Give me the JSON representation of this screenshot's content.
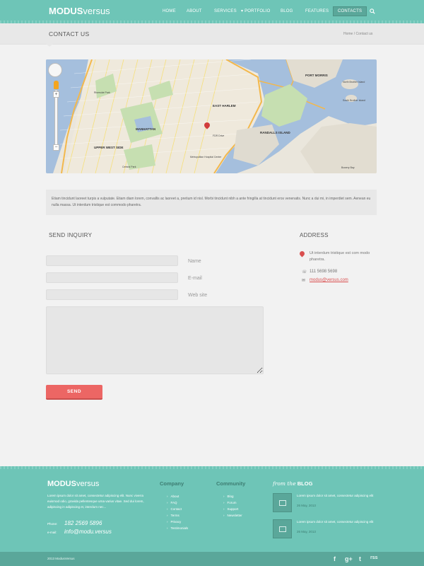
{
  "brand": {
    "name_bold": "MODUS",
    "name_light": "versus"
  },
  "nav": {
    "items": [
      {
        "label": "HOME"
      },
      {
        "label": "ABOUT"
      },
      {
        "label": "SERVICES"
      },
      {
        "label": "PORTFOLIO"
      },
      {
        "label": "BLOG"
      },
      {
        "label": "FEATURES"
      },
      {
        "label": "CONTACTS"
      }
    ],
    "search_icon": "search-icon"
  },
  "titlebar": {
    "title": "CONTACT US",
    "breadcrumb": "Home  /  Contact us"
  },
  "map": {
    "labels": {
      "manhattan": "MANHATTAN",
      "east_harlem": "EAST HARLEM",
      "upper_west_side": "UPPER WEST SIDE",
      "randalls_island": "RANDALLS ISLAND",
      "port_morris": "PORT MORRIS",
      "north_brother": "North Brother Island",
      "south_brother": "South Brother Island",
      "central_park": "Central Park",
      "riverside_park": "Riverside Park",
      "fdr_drive": "FDR Drive",
      "metropolitan": "Metropolitan Hospital Center",
      "riker": "Bowery Bay"
    },
    "zoom_in": "+",
    "zoom_out": "−"
  },
  "intro": {
    "text": "Etiam tincidunt laoreet turpis a vulputate. Etiam diam lorem, convallis ac laoreet a, pretium id nisl. Morbi tincidunt nibh a ante fringilla at tincidunt eros venenatis. Nunc a dui mi, in imperdiet sem. Aenean eu nulla massa. Ut interdum tristique est commodo pharetra."
  },
  "form": {
    "heading": "SEND INQUIRY",
    "fields": [
      {
        "label": "Name",
        "value": ""
      },
      {
        "label": "E-mail",
        "value": ""
      },
      {
        "label": "Web site",
        "value": ""
      }
    ],
    "message_value": "",
    "submit_label": "SEND"
  },
  "address": {
    "heading": "ADDRESS",
    "street": "Ut interdum tristique est com modo pharetra.",
    "phone": "111 5698 5698",
    "email": "modus@versus.com"
  },
  "footer": {
    "logo_bold": "MODUS",
    "logo_light": "versus",
    "about": "Lorem ipsum dolor sit amet, consectetur adipiscing elit. Nunc viverra euismod odio, gravida pellentesque urna varius vitae. Sed dui lorem, adipiscing in adipiscing et, interdum nec...",
    "phone_label": "Phone:",
    "phone": "182 2569 5896",
    "email_label": "e-mail:",
    "email": "info@modu.versus",
    "company": {
      "heading": "Company",
      "links": [
        "About",
        "FAQ",
        "Contact",
        "Terms",
        "Privacy",
        "Testimonials"
      ]
    },
    "community": {
      "heading": "Community",
      "links": [
        "Blog",
        "Forum",
        "Support",
        "Newsletter"
      ]
    },
    "blog": {
      "heading_prefix": "from the",
      "heading": "BLOG",
      "posts": [
        {
          "text": "Lorem ipsum dolor sit amet, consectetur adipiscing elit",
          "date": "26 May, 2013"
        },
        {
          "text": "Lorem ipsum dolor sit amet, consectetur adipiscing elit",
          "date": "26 May, 2013"
        }
      ]
    }
  },
  "bottombar": {
    "copyright": "2013  ModusVersus",
    "social": [
      "f",
      "g+",
      "t",
      "rss"
    ]
  }
}
